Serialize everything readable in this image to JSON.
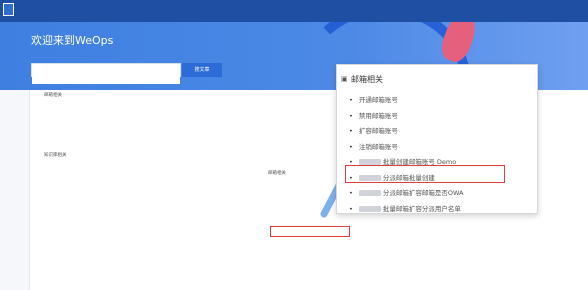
{
  "topbar": {
    "brand": "",
    "nav": [
      {
        "label": "",
        "active": true
      },
      {
        "label": "",
        "active": false
      }
    ]
  },
  "hero": {
    "title": "欢迎来到WeOps",
    "subtitle": "",
    "search_placeholder": "",
    "search_button": "搜文章"
  },
  "sidebar": {
    "items": [
      {
        "label": ""
      },
      {
        "label": ""
      }
    ]
  },
  "sections": {
    "col1_a_title": "邮箱相关",
    "col1_b_title": "知识库相关",
    "col2_a_title": "",
    "col2_b_title": "邮箱相关",
    "col1_a_items": [
      "",
      "",
      "",
      ""
    ],
    "col1_b_items": [
      "",
      "",
      "",
      "",
      "",
      "",
      ""
    ],
    "col2_a_items": [
      "",
      "",
      "",
      "",
      "",
      "",
      ""
    ],
    "col2_b_items": [
      "",
      "",
      "",
      "",
      "",
      "",
      "",
      ""
    ]
  },
  "popup": {
    "title": "邮箱相关",
    "items": [
      "开通邮箱账号",
      "禁用邮箱账号",
      "扩容邮箱账号",
      "注销邮箱账号",
      "批量创建邮箱账号 Demo",
      "分派邮箱批量创建",
      "分派邮箱扩容邮箱是否OWA",
      "批量邮箱扩容分派用户名单"
    ]
  },
  "colors": {
    "topbar": "#1e4fa3",
    "hero": "#4d8ae6",
    "highlight": "#e23c3c"
  }
}
